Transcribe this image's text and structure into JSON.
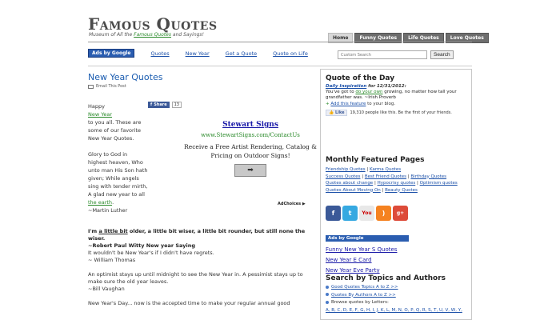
{
  "header": {
    "site_title": "Famous Quotes",
    "tagline_pre": "Museum of All the ",
    "tagline_link": "Famous Quotes",
    "tagline_post": " and Sayings!",
    "tabs": [
      {
        "label": "Home",
        "active": true
      },
      {
        "label": "Funny Quotes",
        "active": false
      },
      {
        "label": "Life Quotes",
        "active": false
      },
      {
        "label": "Love Quotes",
        "active": false
      }
    ]
  },
  "nav": {
    "ads_label": "Ads by Google",
    "links": [
      "Quotes",
      "New Year",
      "Get a Quote",
      "Quote on Life"
    ]
  },
  "search": {
    "placeholder": "Custom Search",
    "google_label": "Google",
    "button_label": "Search"
  },
  "main": {
    "title": "New Year Quotes",
    "email_label": "Email This Post",
    "share_label": "Share",
    "share_count": "13",
    "intro": {
      "line1": "Happy",
      "link": "New Year",
      "line2": "to you all. These are some of our favorite New Year Quotes."
    },
    "quote1": {
      "text": "Glory to God in highest heaven, Who unto man His Son hath given; While angels sing with tender mirth, A glad new year to all ",
      "link": "the earth",
      "end": ".",
      "author": "~Martin Luther"
    },
    "quote2": {
      "lead": "I'm ",
      "link": "a little bit",
      "rest": " older, a little bit wiser, a little bit rounder, but still none the wiser.",
      "saying_title": "~Robert Paul Witty New year Saying",
      "saying_text": "It wouldn't be New Year's if I didn't have regrets.",
      "saying_author": "~ William Thomas"
    },
    "quote3": {
      "text": "An optimist stays up until midnight to see the New Year in. A pessimist stays up to make sure the old year leaves.",
      "author": "~Bill Vaughan"
    },
    "quote4": {
      "text": "New Year's Day... now is the accepted time to make your regular annual good"
    }
  },
  "ad": {
    "title": "Stewart Signs",
    "url": "www.StewartSigns.com/ContactUs",
    "text": "Receive a Free Artist Rendering, Catalog & Pricing on Outdoor Signs!",
    "arrow": "➡",
    "adchoices": "AdChoices ▶"
  },
  "sidebar": {
    "qotd_title": "Quote of the Day",
    "qotd_source": "Daily Inspiration",
    "qotd_date": " for 12/31/2012:",
    "qotd_pre": "You've got to ",
    "qotd_link": "do your own",
    "qotd_post": " growing, no matter how tall your grandfather was.  ~Irish Proverb",
    "add_feature_link": "Add this feature",
    "add_feature_rest": " to your blog.",
    "like_label": "Like",
    "like_text": "19,310 people like this. Be the first of your friends.",
    "monthly_title": "Monthly Featured Pages",
    "monthly_links": [
      "Friendship Quotes",
      "Karma Quotes",
      "Success Quotes",
      "Best Friend Quotes",
      "Birthday Quotes",
      "Quotes about change",
      "Hypocrisy quotes",
      "Optimism quotes",
      "Quotes About Moving On",
      "Beauty Quotes"
    ],
    "social_icons": [
      "facebook-icon",
      "twitter-icon",
      "youtube-icon",
      "rss-icon",
      "google-plus-icon"
    ],
    "ads_label": "Ads by Google",
    "ad_links": [
      "Funny New Year S Quotes",
      "New Year E Card",
      "New Year Eve Party"
    ],
    "topics_title": "Search by Topics and Authors",
    "topics": [
      "Good Quotes Topics A to Z >>",
      "Quotes By Authors A to Z >>",
      "Browse quotes by Letters:"
    ],
    "letters": "A, B, C, D, E, F, G, H, I, J, K, L, M, N, O, P, Q, R, S, T, U, V, W, Y,"
  }
}
